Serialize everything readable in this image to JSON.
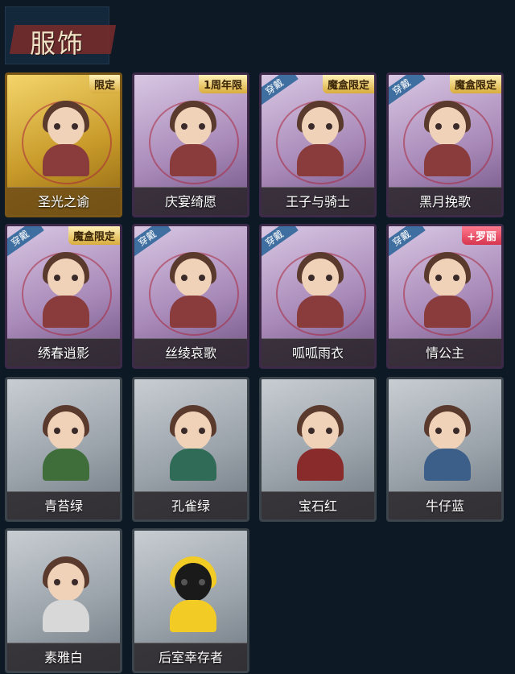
{
  "section_title": "服饰",
  "cards": [
    {
      "name": "圣光之谕",
      "badge": "限定",
      "wear": "",
      "theme": "gold",
      "badge_color": "gold"
    },
    {
      "name": "庆宴绮愿",
      "badge": "1周年限",
      "wear": "",
      "theme": "purple",
      "badge_color": "gold"
    },
    {
      "name": "王子与骑士",
      "badge": "魔盒限定",
      "wear": "穿戴",
      "theme": "purple",
      "badge_color": "gold"
    },
    {
      "name": "黑月挽歌",
      "badge": "魔盒限定",
      "wear": "穿戴",
      "theme": "purple",
      "badge_color": "gold"
    },
    {
      "name": "绣春逍影",
      "badge": "魔盒限定",
      "wear": "穿戴",
      "theme": "purple",
      "badge_color": "gold"
    },
    {
      "name": "丝绫哀歌",
      "badge": "",
      "wear": "穿戴",
      "theme": "purple",
      "badge_color": "gold"
    },
    {
      "name": "呱呱雨衣",
      "badge": "",
      "wear": "穿戴",
      "theme": "purple",
      "badge_color": "gold"
    },
    {
      "name": "情公主",
      "badge": "+罗丽",
      "wear": "穿戴",
      "theme": "purple",
      "badge_color": "red"
    },
    {
      "name": "青苔绿",
      "badge": "",
      "wear": "",
      "theme": "gray",
      "badge_color": "gold",
      "body_color": "#3f6e3a"
    },
    {
      "name": "孔雀绿",
      "badge": "",
      "wear": "",
      "theme": "gray",
      "badge_color": "gold",
      "body_color": "#2f6b57"
    },
    {
      "name": "宝石红",
      "badge": "",
      "wear": "",
      "theme": "gray",
      "badge_color": "gold",
      "body_color": "#8a2b2b"
    },
    {
      "name": "牛仔蓝",
      "badge": "",
      "wear": "",
      "theme": "gray",
      "badge_color": "gold",
      "body_color": "#3c5f8a"
    },
    {
      "name": "素雅白",
      "badge": "",
      "wear": "",
      "theme": "gray",
      "badge_color": "gold",
      "body_color": "#d8d8d8"
    },
    {
      "name": "后室幸存者",
      "badge": "",
      "wear": "",
      "theme": "gray",
      "badge_color": "gold",
      "body_color": "#f2cc24"
    }
  ]
}
